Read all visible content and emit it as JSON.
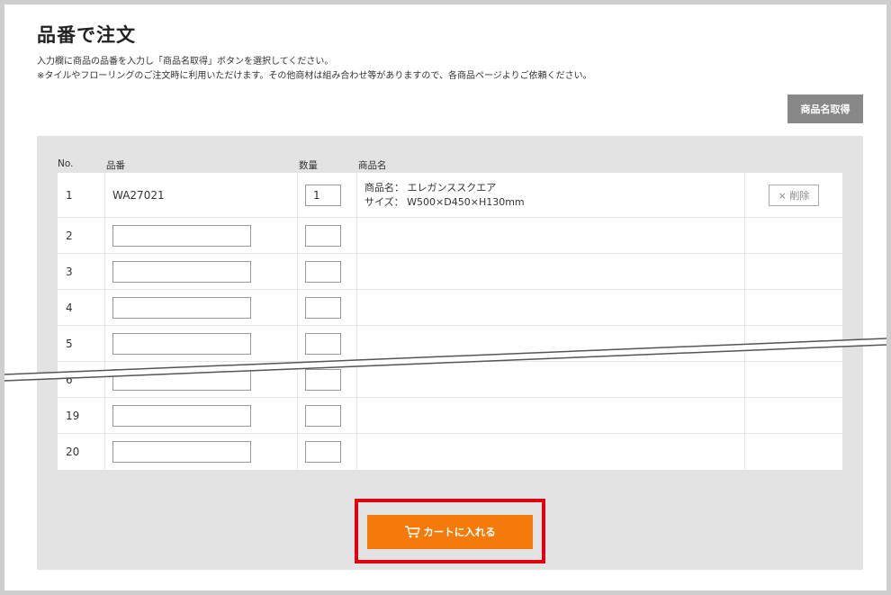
{
  "page": {
    "title": "品番で注文",
    "instruction_1": "入力欄に商品の品番を入力し「商品名取得」ボタンを選択してください。",
    "instruction_2": "※タイルやフローリングのご注文時に利用いただけます。その他商材は組み合わせ等がありますので、各商品ページよりご依頼ください。",
    "fetch_button": "商品名取得"
  },
  "table": {
    "headers": {
      "no": "No.",
      "code": "品番",
      "qty": "数量",
      "name": "商品名"
    },
    "rows": [
      {
        "no": "1",
        "code": "WA27021",
        "qty": "1",
        "name_line": "商品名： エレガンススクエア",
        "size_line": "サイズ： W500×D450×H130mm",
        "delete": "× 削除"
      },
      {
        "no": "2"
      },
      {
        "no": "3"
      },
      {
        "no": "4"
      },
      {
        "no": "5"
      },
      {
        "no": "6"
      },
      {
        "no": "19"
      },
      {
        "no": "20"
      }
    ]
  },
  "cart_button": {
    "label": "カートに入れる",
    "icon": "cart-icon"
  },
  "colors": {
    "accent": "#f47a0a",
    "highlight": "#e3000f",
    "panel": "#e3e3e3",
    "fetch_button": "#888888"
  }
}
